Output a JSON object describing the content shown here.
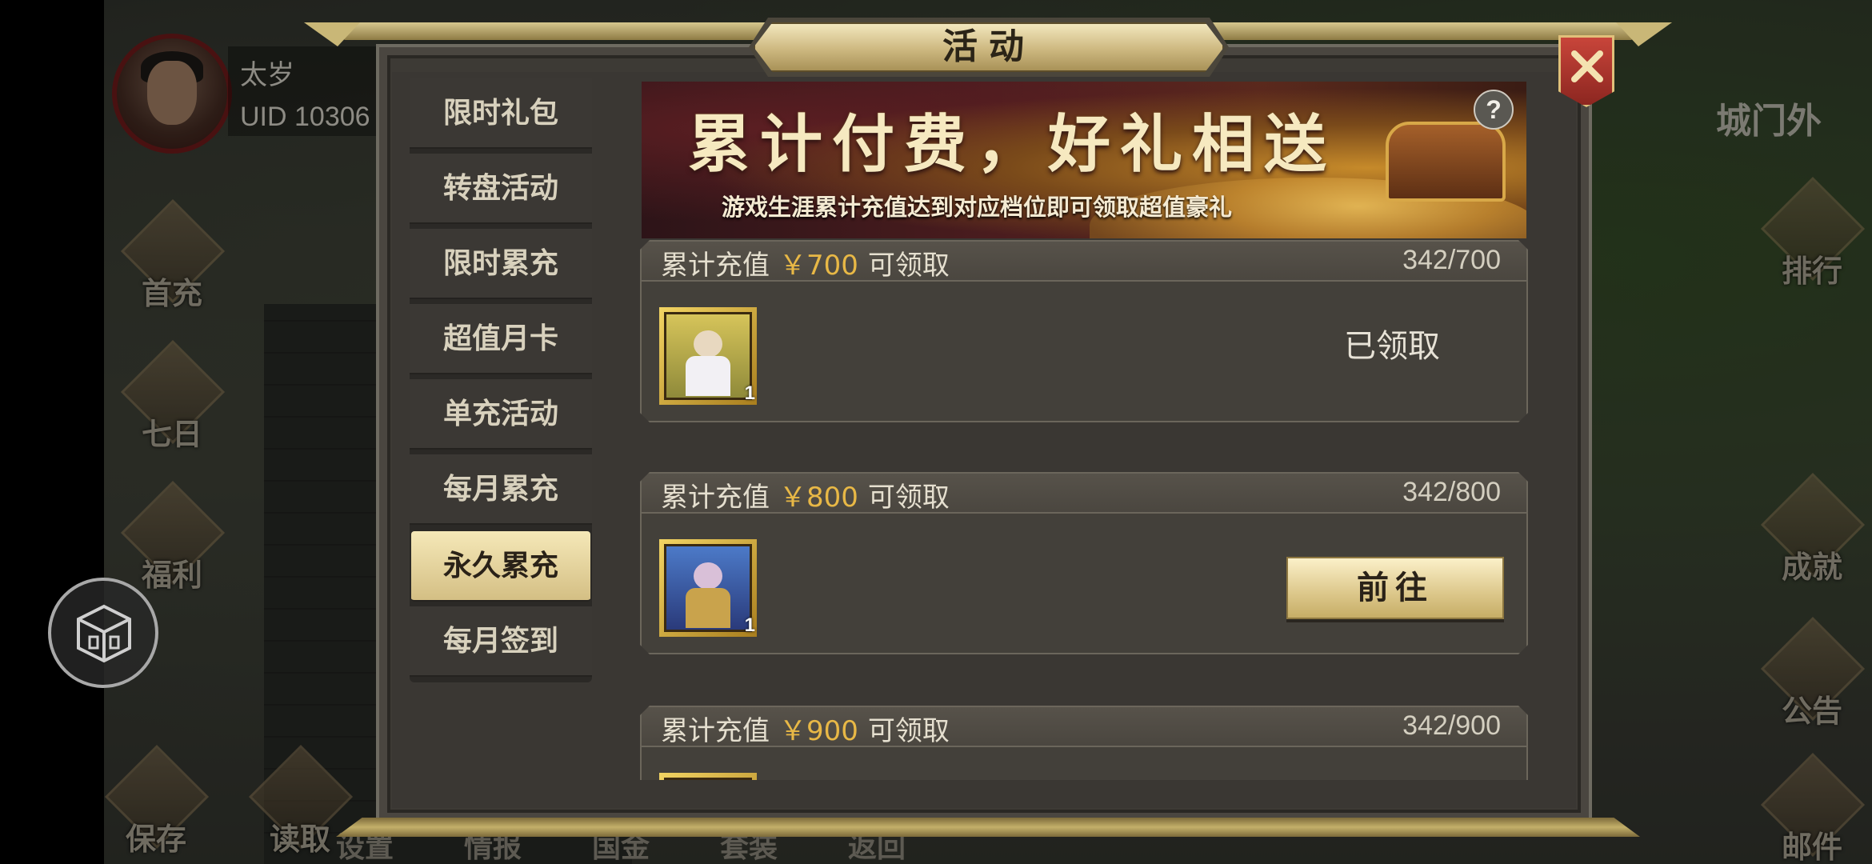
{
  "player": {
    "name": "太岁",
    "uid": "UID 10306"
  },
  "hud_left": [
    {
      "label": "首充",
      "icon": "gift-box-icon"
    },
    {
      "label": "七日",
      "icon": "scroll-icon"
    },
    {
      "label": "福利",
      "icon": "treasure-icon"
    }
  ],
  "hud_right": [
    {
      "label": "排行",
      "icon": "ranking-plaque-icon"
    },
    {
      "label": "成就",
      "icon": "jade-trophy-icon"
    },
    {
      "label": "公告",
      "icon": "horn-icon"
    },
    {
      "label": "邮件",
      "icon": "mail-icon"
    }
  ],
  "bottom_bar": [
    "保存",
    "读取",
    "设置",
    "情报",
    "国金",
    "套装",
    "返回"
  ],
  "location_label": "城门外",
  "dialog": {
    "title": "活动",
    "tabs": [
      {
        "label": "限时礼包"
      },
      {
        "label": "转盘活动"
      },
      {
        "label": "限时累充"
      },
      {
        "label": "超值月卡"
      },
      {
        "label": "单充活动"
      },
      {
        "label": "每月累充"
      },
      {
        "label": "永久累充",
        "active": true
      },
      {
        "label": "每月签到"
      }
    ],
    "banner": {
      "title": "累计付费，好礼相送",
      "subtitle": "游戏生涯累计充值达到对应档位即可领取超值豪礼",
      "help_label": "?"
    },
    "rewards": [
      {
        "prefix": "累计充值",
        "amount": "￥700",
        "suffix": "可领取",
        "progress": "342/700",
        "item_qty": "1",
        "status": "已领取",
        "action": null
      },
      {
        "prefix": "累计充值",
        "amount": "￥800",
        "suffix": "可领取",
        "progress": "342/800",
        "item_qty": "1",
        "status": null,
        "action": "前往"
      },
      {
        "prefix": "累计充值",
        "amount": "￥900",
        "suffix": "可领取",
        "progress": "342/900",
        "item_qty": "",
        "status": null,
        "action": null
      }
    ]
  },
  "colors": {
    "accent_gold": "#e8b846",
    "tab_active_bg": "#e8d9a6",
    "close_red": "#b63a30"
  }
}
